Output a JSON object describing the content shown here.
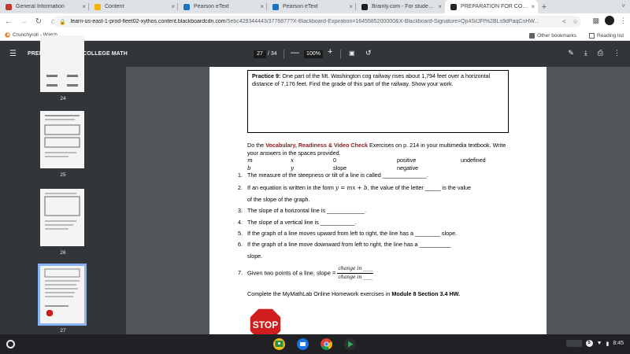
{
  "browser": {
    "tabs": [
      {
        "title": "General Information",
        "favicon": "course-icon",
        "favicon_color": "#c6392e",
        "active": false
      },
      {
        "title": "Content",
        "favicon": "content-icon",
        "favicon_color": "#f4b400",
        "active": false
      },
      {
        "title": "Pearson eText",
        "favicon": "pearson-icon",
        "favicon_color": "#1a73c8",
        "active": false
      },
      {
        "title": "Pearson eText",
        "favicon": "pearson-icon",
        "favicon_color": "#1a73c8",
        "active": false
      },
      {
        "title": "Brainly.com - For students.",
        "favicon": "brainly-icon",
        "favicon_color": "#1f1f1f",
        "active": false
      },
      {
        "title": "PREPARATION FOR COLLEGE",
        "favicon": "blackboard-icon",
        "favicon_color": "#262626",
        "active": true
      }
    ],
    "url_host": "learn-us-east-1-prod-fleet02-xythos.content.blackboardcdn.com",
    "url_path": "/5ebc429344443/3776877?X-Blackboard-Expiration=1645585200000&X-Blackboard-Signature=Qp4SilJFf%2BLs9dPaqCnHW...",
    "bookmarks": [
      {
        "label": "Crunchyroll - Watch...",
        "icon": "crunchyroll-icon"
      }
    ],
    "other_bookmarks": "Other bookmarks",
    "reading_list": "Reading list"
  },
  "pdf": {
    "title": "PREPARATION FOR COLLEGE MATH",
    "current_page": "27",
    "total_pages": "/ 34",
    "zoom": "100%",
    "thumbnails": [
      "24",
      "25",
      "26",
      "27"
    ]
  },
  "document": {
    "practice_label": "Practice 9:",
    "practice_text": " One part of the Mt. Washington cog railway rises about 1,794 feet over a horizontal distance of 7,176 feet. Find the grade of this part of the railway.  Show your work.",
    "intro_pre": "Do the ",
    "intro_vocab": "Vocabulary, Readiness & Video Check",
    "intro_post": " Exercises on p. 214 in your multimedia textbook. Write your answers in the spaces provided.",
    "word_bank": {
      "row1": [
        "m",
        "x",
        "0",
        "positive",
        "undefined"
      ],
      "row2": [
        "b",
        "y",
        "slope",
        "negative"
      ]
    },
    "questions": [
      {
        "num": "1.",
        "text": "The measure of the steepness or tilt of a line is called ______________."
      },
      {
        "num": "2.",
        "pre": "If an equation is written in the form ",
        "math": "y = mx + b",
        "post": ", the value of the letter _____ is the value"
      },
      {
        "num": "",
        "text": "of the slope of the graph."
      },
      {
        "num": "3.",
        "text": "The slope of a horizontal line is ____________."
      },
      {
        "num": "4.",
        "text": "The slope of a vertical line is ___________."
      },
      {
        "num": "5.",
        "text": "If the graph of a line moves upward from left to right, the line has a ________ slope."
      },
      {
        "num": "6.",
        "text": "If the graph of a line move downward from left to right, the line has a __________"
      },
      {
        "num": "",
        "text": "slope."
      }
    ],
    "q7_num": "7.",
    "q7_text": "Given two points of a line, slope = ",
    "q7_numerator": "change in ____",
    "q7_denominator": "change in ____",
    "complete_pre": "Complete the MyMathLab Online Homework exercises in ",
    "complete_bold": "Module 8 Section 3.4 HW.",
    "stop_text": "STOP"
  },
  "shelf": {
    "apps": [
      "classroom-icon",
      "files-icon",
      "chrome-icon",
      "play-store-icon"
    ],
    "notification_count": "5",
    "time": "8:45"
  }
}
